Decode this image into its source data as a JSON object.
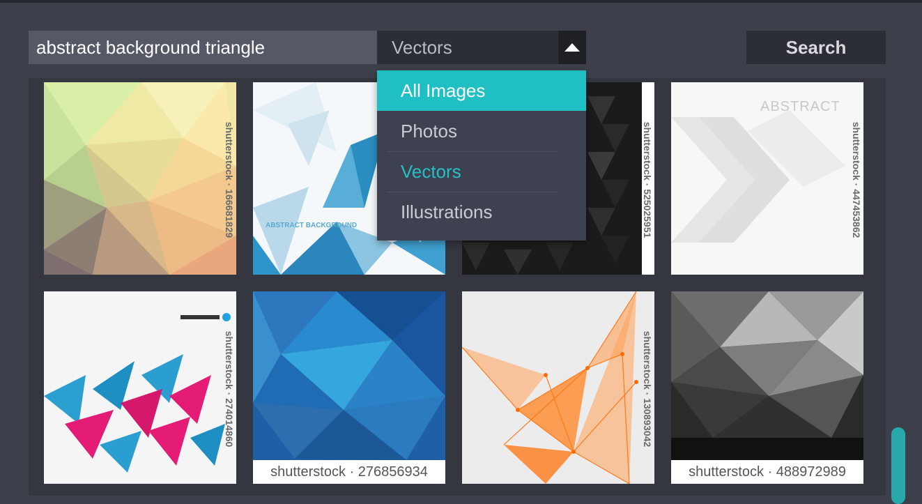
{
  "search": {
    "query": "abstract background triangle",
    "button_label": "Search"
  },
  "filter": {
    "selected": "Vectors",
    "options": [
      "All Images",
      "Photos",
      "Vectors",
      "Illustrations"
    ],
    "highlighted": "All Images",
    "arrow_icon": "triangle-up-icon"
  },
  "results": [
    {
      "watermark": "shutterstock · 166681829",
      "art": "pastel-lowpoly"
    },
    {
      "watermark": "",
      "art": "blue-triangle-brochure",
      "caption": "ABSTRACT BACKGROUND"
    },
    {
      "watermark": "shutterstock · 525025951",
      "art": "dark-triangle-mosaic"
    },
    {
      "watermark": "shutterstock · 447453862",
      "art": "white-chevron",
      "caption": "ABSTRACT"
    },
    {
      "watermark": "shutterstock · 274014860",
      "art": "pink-blue-pyramids"
    },
    {
      "watermark": "shutterstock · 276856934",
      "art": "blue-lowpoly"
    },
    {
      "watermark": "shutterstock · 130893042",
      "art": "orange-network"
    },
    {
      "watermark": "shutterstock · 488972989",
      "art": "gray-lowpoly"
    }
  ],
  "colors": {
    "accent": "#1fbfc4",
    "background": "#3d404b",
    "panel": "#343740"
  }
}
